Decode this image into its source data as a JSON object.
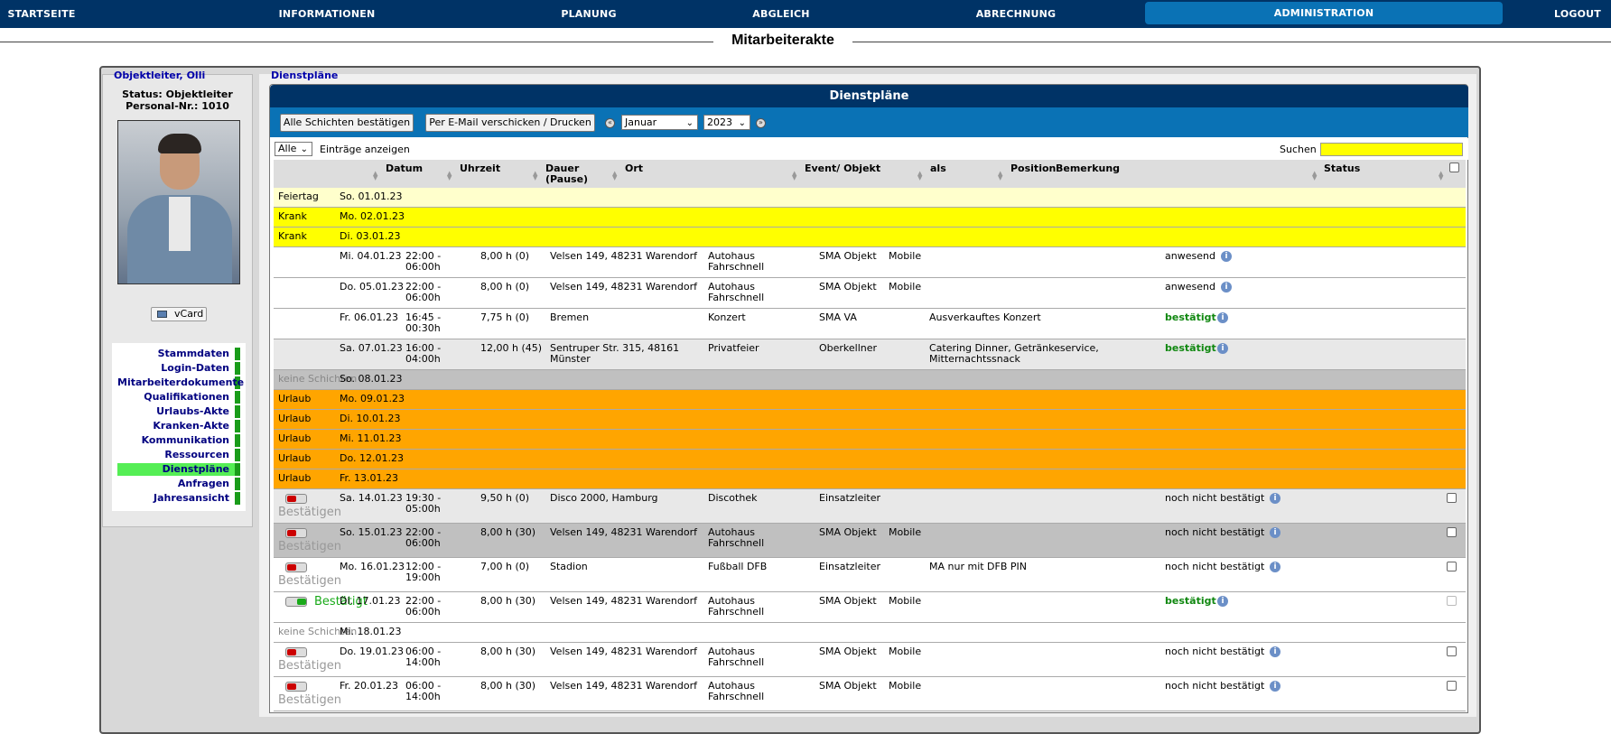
{
  "nav": {
    "items": [
      "STARTSEITE",
      "INFORMATIONEN",
      "PLANUNG",
      "ABGLEICH",
      "ABRECHNUNG",
      "ADMINISTRATION",
      "LOGOUT"
    ],
    "active": "ADMINISTRATION"
  },
  "page": {
    "title": "Mitarbeiterakte"
  },
  "employee": {
    "name": "Objektleiter, Olli",
    "status": "Status: Objektleiter",
    "personal_nr": "Personal-Nr.: 1010",
    "vcard": "vCard"
  },
  "menu": {
    "items": [
      "Stammdaten",
      "Login-Daten",
      "Mitarbeiterdokumente",
      "Qualifikationen",
      "Urlaubs-Akte",
      "Kranken-Akte",
      "Kommunikation",
      "Ressourcen",
      "Dienstpläne",
      "Anfragen",
      "Jahresansicht"
    ],
    "active": "Dienstpläne"
  },
  "breadcrumb": "Dienstpläne",
  "panel": {
    "title": "Dienstpläne",
    "confirm_all": "Alle Schichten bestätigen",
    "email_print": "Per E-Mail verschicken / Drucken",
    "month": "Januar",
    "year": "2023",
    "prev_icon": "«",
    "next_icon": "»"
  },
  "controls": {
    "show_value": "Alle",
    "entries_label": "Einträge anzeigen",
    "search_label": "Suchen",
    "search_value": ""
  },
  "columns": {
    "datum": "Datum",
    "uhrzeit": "Uhrzeit",
    "dauer1": "Dauer",
    "dauer2": "(Pause)",
    "ort": "Ort",
    "event": "Event/ Objekt",
    "als": "als",
    "position": "Position",
    "bemerkung": "Bemerkung",
    "status": "Status"
  },
  "colors": {
    "nav": "#003366",
    "accent": "#0a72b5",
    "feiertag": "#ffffcc",
    "krank": "#ffff00",
    "urlaub": "#ffa500",
    "keine": "#c0c0c0"
  },
  "rows": [
    {
      "kind": "Feiertag",
      "datum": "So. 01.01.23"
    },
    {
      "kind": "Krank",
      "datum": "Mo. 02.01.23"
    },
    {
      "kind": "Krank",
      "datum": "Di. 03.01.23"
    },
    {
      "kind": "shift",
      "datum": "Mi. 04.01.23",
      "uhrzeit": [
        "22:00 -",
        "06:00h"
      ],
      "dauer": "8,00 h (0)",
      "ort": [
        "Velsen 149, 48231 Warendorf"
      ],
      "event": [
        "Autohaus",
        "Fahrschnell"
      ],
      "als": "SMA Objekt",
      "position": "Mobile",
      "bemerkung": [],
      "status": "anwesend",
      "status_style": "plain"
    },
    {
      "kind": "shift",
      "datum": "Do. 05.01.23",
      "uhrzeit": [
        "22:00 -",
        "06:00h"
      ],
      "dauer": "8,00 h (0)",
      "ort": [
        "Velsen 149, 48231 Warendorf"
      ],
      "event": [
        "Autohaus",
        "Fahrschnell"
      ],
      "als": "SMA Objekt",
      "position": "Mobile",
      "bemerkung": [],
      "status": "anwesend",
      "status_style": "plain"
    },
    {
      "kind": "shift",
      "datum": "Fr. 06.01.23",
      "uhrzeit": [
        "16:45 -",
        "00:30h"
      ],
      "dauer": "7,75 h (0)",
      "ort": [
        "Bremen"
      ],
      "event": [
        "Konzert"
      ],
      "als": "SMA VA",
      "position": "",
      "bemerkung": [
        "Ausverkauftes Konzert"
      ],
      "status": "bestätigt",
      "status_style": "green"
    },
    {
      "kind": "shift",
      "datum": "Sa. 07.01.23",
      "uhrzeit": [
        "16:00 -",
        "04:00h"
      ],
      "dauer": "12,00 h (45)",
      "ort": [
        "Sentruper Str. 315, 48161",
        "Münster"
      ],
      "event": [
        "Privatfeier"
      ],
      "als": "Oberkellner",
      "position": "",
      "bemerkung": [
        "Catering Dinner, Getränkeservice,",
        "Mitternachtssnack"
      ],
      "status": "bestätigt",
      "status_style": "green",
      "bg": "#e8e8e8"
    },
    {
      "kind": "keine Schichten",
      "datum": "So. 08.01.23",
      "bg": "#c0c0c0"
    },
    {
      "kind": "Urlaub",
      "datum": "Mo. 09.01.23"
    },
    {
      "kind": "Urlaub",
      "datum": "Di. 10.01.23"
    },
    {
      "kind": "Urlaub",
      "datum": "Mi. 11.01.23"
    },
    {
      "kind": "Urlaub",
      "datum": "Do. 12.01.23"
    },
    {
      "kind": "Urlaub",
      "datum": "Fr. 13.01.23"
    },
    {
      "kind": "shift",
      "toggle": "off",
      "toggle_label": "Bestätigen",
      "datum": "Sa. 14.01.23",
      "uhrzeit": [
        "19:30 -",
        "05:00h"
      ],
      "dauer": "9,50 h (0)",
      "ort": [
        "Disco 2000, Hamburg"
      ],
      "event": [
        "Discothek"
      ],
      "als": "Einsatzleiter",
      "position": "",
      "bemerkung": [],
      "status": "noch nicht bestätigt",
      "status_style": "plain",
      "check": true,
      "bg": "#e8e8e8"
    },
    {
      "kind": "shift",
      "toggle": "off",
      "toggle_label": "Bestätigen",
      "datum": "So. 15.01.23",
      "uhrzeit": [
        "22:00 -",
        "06:00h"
      ],
      "dauer": "8,00 h (30)",
      "ort": [
        "Velsen 149, 48231 Warendorf"
      ],
      "event": [
        "Autohaus",
        "Fahrschnell"
      ],
      "als": "SMA Objekt",
      "position": "Mobile",
      "bemerkung": [],
      "status": "noch nicht bestätigt",
      "status_style": "plain",
      "check": true,
      "bg": "#c0c0c0"
    },
    {
      "kind": "shift",
      "toggle": "off",
      "toggle_label": "Bestätigen",
      "datum": "Mo. 16.01.23",
      "uhrzeit": [
        "12:00 -",
        "19:00h"
      ],
      "dauer": "7,00 h (0)",
      "ort": [
        "Stadion"
      ],
      "event": [
        "Fußball DFB"
      ],
      "als": "Einsatzleiter",
      "position": "",
      "bemerkung": [
        "MA nur mit DFB PIN"
      ],
      "status": "noch nicht bestätigt",
      "status_style": "plain",
      "check": true
    },
    {
      "kind": "shift",
      "toggle": "on",
      "toggle_label": "Bestätigt",
      "datum": "Di. 17.01.23",
      "uhrzeit": [
        "22:00 -",
        "06:00h"
      ],
      "dauer": "8,00 h (30)",
      "ort": [
        "Velsen 149, 48231 Warendorf"
      ],
      "event": [
        "Autohaus",
        "Fahrschnell"
      ],
      "als": "SMA Objekt",
      "position": "Mobile",
      "bemerkung": [],
      "status": "bestätigt",
      "status_style": "green",
      "check": true,
      "check_disabled": true
    },
    {
      "kind": "keine Schichten",
      "datum": "Mi. 18.01.23"
    },
    {
      "kind": "shift",
      "toggle": "off",
      "toggle_label": "Bestätigen",
      "datum": "Do. 19.01.23",
      "uhrzeit": [
        "06:00 -",
        "14:00h"
      ],
      "dauer": "8,00 h (30)",
      "ort": [
        "Velsen 149, 48231 Warendorf"
      ],
      "event": [
        "Autohaus",
        "Fahrschnell"
      ],
      "als": "SMA Objekt",
      "position": "Mobile",
      "bemerkung": [],
      "status": "noch nicht bestätigt",
      "status_style": "plain",
      "check": true
    },
    {
      "kind": "shift",
      "toggle": "off",
      "toggle_label": "Bestätigen",
      "datum": "Fr. 20.01.23",
      "uhrzeit": [
        "06:00 -",
        "14:00h"
      ],
      "dauer": "8,00 h (30)",
      "ort": [
        "Velsen 149, 48231 Warendorf"
      ],
      "event": [
        "Autohaus",
        "Fahrschnell"
      ],
      "als": "SMA Objekt",
      "position": "Mobile",
      "bemerkung": [],
      "status": "noch nicht bestätigt",
      "status_style": "plain",
      "check": true
    }
  ]
}
